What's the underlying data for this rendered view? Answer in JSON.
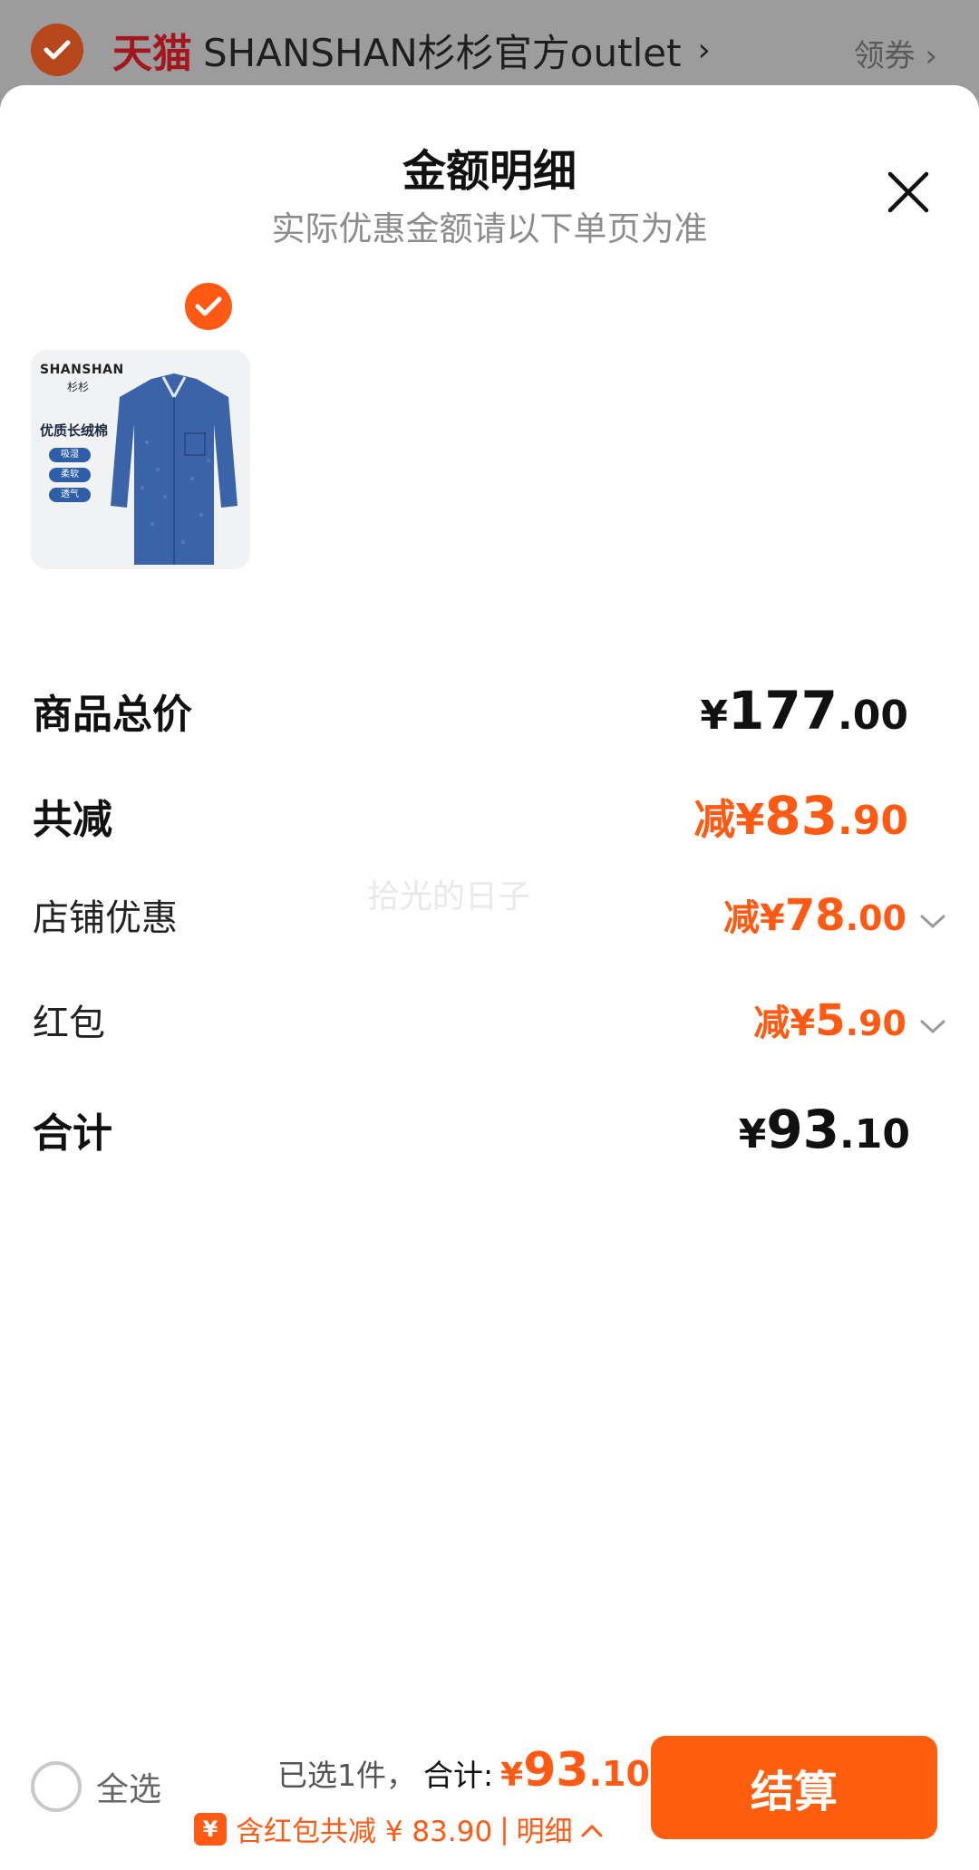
{
  "store": {
    "platform": "天猫",
    "name": "SHANSHAN杉杉官方outlet",
    "arrow": "›",
    "coupon_label": "领券 ›"
  },
  "sheet": {
    "title": "金额明细",
    "subtitle": "实际优惠金额请以下单页为准"
  },
  "product": {
    "brand": "SHANSHAN",
    "brand_cn": "杉杉",
    "feature": "优质长绒棉",
    "tags": [
      "吸湿",
      "柔软",
      "透气"
    ],
    "selected": true
  },
  "rows": {
    "goods_total": {
      "label": "商品总价",
      "yen": "¥",
      "int": "177",
      "dec": ".00"
    },
    "total_reduction": {
      "label": "共减",
      "prefix": "减¥",
      "int": "83",
      "dec": ".90"
    },
    "store_discount": {
      "label": "店铺优惠",
      "prefix": "减¥",
      "int": "78",
      "dec": ".00"
    },
    "red_packet": {
      "label": "红包",
      "prefix": "减¥",
      "int": "5",
      "dec": ".90"
    },
    "sum": {
      "label": "合计",
      "yen": "¥",
      "int": "93",
      "dec": ".10"
    }
  },
  "watermark": "拾光的日子",
  "bottom": {
    "select_all": "全选",
    "selected_count": "已选1件，",
    "total_label": "合计:",
    "total_yen": "¥",
    "total_int": "93",
    "total_dec": ".10",
    "redpack_icon": "¥",
    "redpack_text": "含红包共减 ¥ 83.90",
    "separator": "|",
    "detail_label": "明细",
    "checkout": "结算"
  },
  "colors": {
    "accent": "#ff5a14",
    "tmall_red": "#a4161d",
    "overlay": "#9c9c9c"
  }
}
